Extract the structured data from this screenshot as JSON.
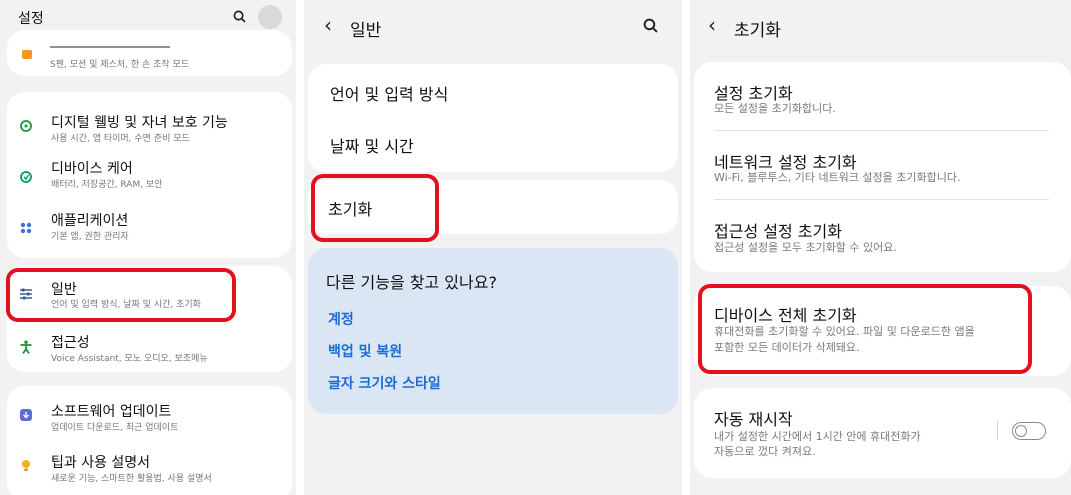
{
  "panel1": {
    "title": "설정",
    "items": [
      {
        "title": "",
        "sub": "S펜, 모션 및 제스처, 한 손 조작 모드"
      },
      {
        "title": "디지털 웰빙 및 자녀 보호 기능",
        "sub": "사용 시간, 앱 타이머, 수면 준비 모드"
      },
      {
        "title": "디바이스 케어",
        "sub": "배터리, 저장공간, RAM, 보안"
      },
      {
        "title": "애플리케이션",
        "sub": "기본 앱, 권한 관리자"
      },
      {
        "title": "일반",
        "sub": "언어 및 입력 방식, 날짜 및 시간, 초기화"
      },
      {
        "title": "접근성",
        "sub": "Voice Assistant, 모노 오디오, 보조메뉴"
      },
      {
        "title": "소프트웨어 업데이트",
        "sub": "업데이트 다운로드, 최근 업데이트"
      },
      {
        "title": "팁과 사용 설명서",
        "sub": "새로운 기능, 스마트한 활용법, 사용 설명서"
      }
    ]
  },
  "panel2": {
    "title": "일반",
    "items": [
      "언어 및 입력 방식",
      "날짜 및 시간",
      "초기화"
    ],
    "suggest_title": "다른 기능을 찾고 있나요?",
    "links": [
      "계정",
      "백업 및 복원",
      "글자 크기와 스타일"
    ]
  },
  "panel3": {
    "title": "초기화",
    "items": [
      {
        "title": "설정 초기화",
        "sub": "모든 설정을 초기화합니다."
      },
      {
        "title": "네트워크 설정 초기화",
        "sub": "Wi-Fi, 블루투스, 기타 네트워크 설정을 초기화합니다."
      },
      {
        "title": "접근성 설정 초기화",
        "sub": "접근성 설정을 모두 초기화할 수 있어요."
      },
      {
        "title": "디바이스 전체 초기화",
        "sub1": "휴대전화를 초기화할 수 있어요. 파일 및 다운로드한 앱을",
        "sub2": "포함한 모든 데이터가 삭제돼요."
      },
      {
        "title": "자동 재시작",
        "sub1": "내가 설정한 시간에서 1시간 안에 휴대전화가",
        "sub2": "자동으로 껐다 켜져요."
      }
    ],
    "auto_restart_on": false
  },
  "colors": {
    "highlight": "#e3101e",
    "link": "#1b6bd4",
    "background": "#f2f2f2"
  }
}
